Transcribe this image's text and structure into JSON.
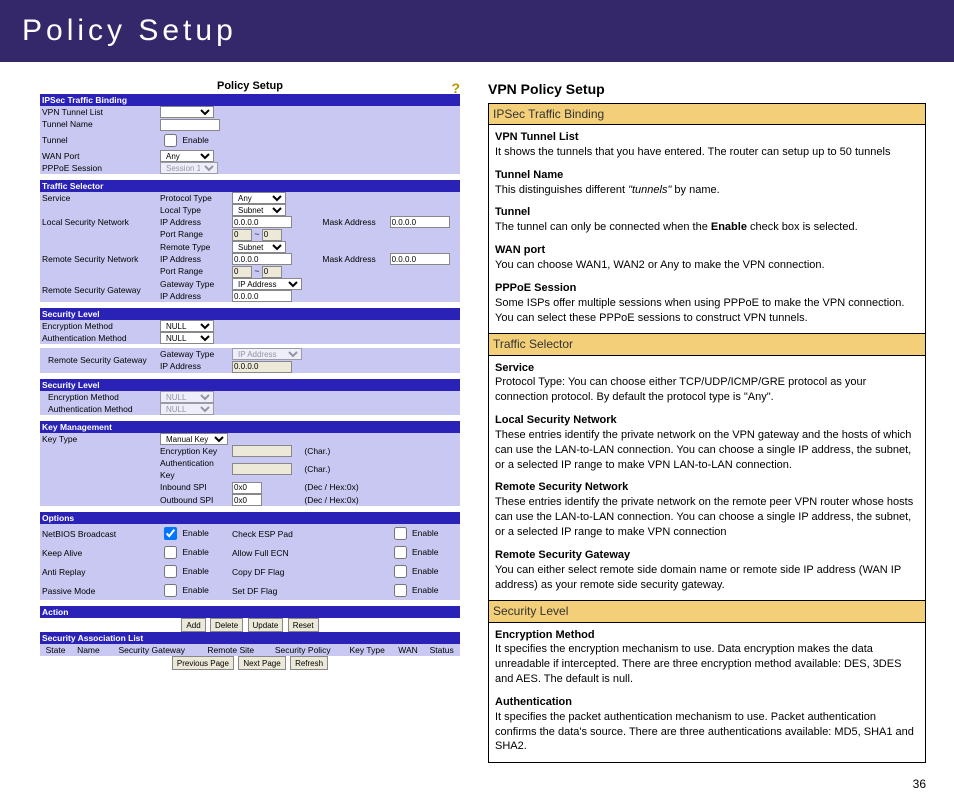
{
  "header": {
    "title": "Policy Setup"
  },
  "router": {
    "title": "Policy Setup",
    "sections": {
      "ipsec_binding": "IPSec Traffic Binding",
      "traffic_selector": "Traffic Selector",
      "security_level": "Security Level",
      "security_level2": "Security Level",
      "key_mgmt": "Key Management",
      "options": "Options",
      "action": "Action",
      "sa_list": "Security Association List"
    },
    "labels": {
      "vpn_tunnel_list": "VPN Tunnel List",
      "tunnel_name": "Tunnel Name",
      "tunnel": "Tunnel",
      "wan_port": "WAN Port",
      "pppoe_session": "PPPoE Session",
      "service": "Service",
      "local_sec_net": "Local Security Network",
      "remote_sec_net": "Remote Security Network",
      "remote_sec_gw": "Remote Security Gateway",
      "encryption_method": "Encryption Method",
      "auth_method": "Authentication Method",
      "key_type": "Key Type",
      "netbios": "NetBIOS Broadcast",
      "keep_alive": "Keep Alive",
      "anti_replay": "Anti Replay",
      "passive_mode": "Passive Mode"
    },
    "sublabels": {
      "protocol_type": "Protocol Type",
      "local_type": "Local Type",
      "ip_address": "IP Address",
      "port_range": "Port Range",
      "remote_type": "Remote Type",
      "gateway_type": "Gateway Type",
      "encryption_key": "Encryption Key",
      "authentication_key": "Authentication Key",
      "inbound_spi": "Inbound SPI",
      "outbound_spi": "Outbound SPI",
      "mask_address": "Mask Address",
      "check_esp_pad": "Check ESP Pad",
      "allow_full_ecn": "Allow Full ECN",
      "copy_df_flag": "Copy DF Flag",
      "set_df_flag": "Set DF Flag",
      "char": "(Char.)",
      "dechex": "(Dec / Hex:0x)",
      "enable": "Enable"
    },
    "values": {
      "wan_port": "Any",
      "pppoe_session": "Session 1",
      "protocol_type": "Any",
      "local_type": "Subnet",
      "remote_type": "Subnet",
      "gateway_type": "IP Address",
      "ip_zero": "0.0.0.0",
      "port_zero": "0",
      "enc_method": "NULL",
      "auth_method": "NULL",
      "key_type": "Manual Key",
      "spi": "0x0"
    },
    "buttons": {
      "add": "Add",
      "delete": "Delete",
      "update": "Update",
      "reset": "Reset",
      "prev": "Previous Page",
      "next": "Next Page",
      "refresh": "Refresh"
    },
    "sa_cols": {
      "state": "State",
      "name": "Name",
      "gw": "Security Gateway",
      "remote": "Remote Site",
      "policy": "Security Policy",
      "key": "Key Type",
      "wan": "WAN",
      "status": "Status"
    }
  },
  "doc": {
    "title": "VPN Policy Setup",
    "ipsec_h": "IPSec Traffic Binding",
    "traffic_h": "Traffic Selector",
    "sec_h": "Security Level",
    "vpn_tunnel_list_t": "VPN Tunnel List",
    "vpn_tunnel_list_b": "It shows the tunnels that you have entered. The router can setup up to 50 tunnels",
    "tunnel_name_t": "Tunnel Name",
    "tunnel_name_b1": "This distinguishes different ",
    "tunnel_name_i": "\"tunnels\"",
    "tunnel_name_b2": " by name.",
    "tunnel_t": "Tunnel",
    "tunnel_b1": "The tunnel can only be connected when the ",
    "tunnel_bold": "Enable",
    "tunnel_b2": " check box is selected.",
    "wan_t": "WAN port",
    "wan_b": "You can choose WAN1, WAN2 or Any to make the VPN connection.",
    "pppoe_t": "PPPoE Session",
    "pppoe_b": "Some ISPs offer multiple sessions when using PPPoE to make the  VPN connection.  You can select these PPPoE sessions to construct VPN tunnels.",
    "service_t": "Service",
    "service_b": "Protocol Type: You can choose either TCP/UDP/ICMP/GRE protocol as your connection protocol. By default the protocol type is \"Any\".",
    "lsn_t": "Local Security Network",
    "lsn_b": "These entries identify the private network on the VPN gateway and the hosts of which can use the LAN-to-LAN connection. You can choose a single IP address, the subnet, or a selected IP range to make VPN LAN-to-LAN connection.",
    "rsn_t": "Remote Security Network",
    "rsn_b": "These entries identify the private network on the remote peer VPN router whose hosts can use the LAN-to-LAN connection. You can choose a single IP address, the subnet, or a selected IP range to make VPN connection",
    "rsg_t": "Remote Security Gateway",
    "rsg_b": "You can either select remote side domain name or remote side IP address (WAN IP address) as your remote side security gateway.",
    "enc_t": "Encryption Method",
    "enc_b": "It specifies the encryption mechanism to use. Data encryption makes the data unreadable if intercepted. There are three encryption method available: DES, 3DES and AES. The default is null.",
    "auth_t": "Authentication",
    "auth_b": "It specifies the packet authentication mechanism to use. Packet authentication confirms the data's source. There are three authentications available: MD5, SHA1 and SHA2."
  },
  "page_number": "36"
}
